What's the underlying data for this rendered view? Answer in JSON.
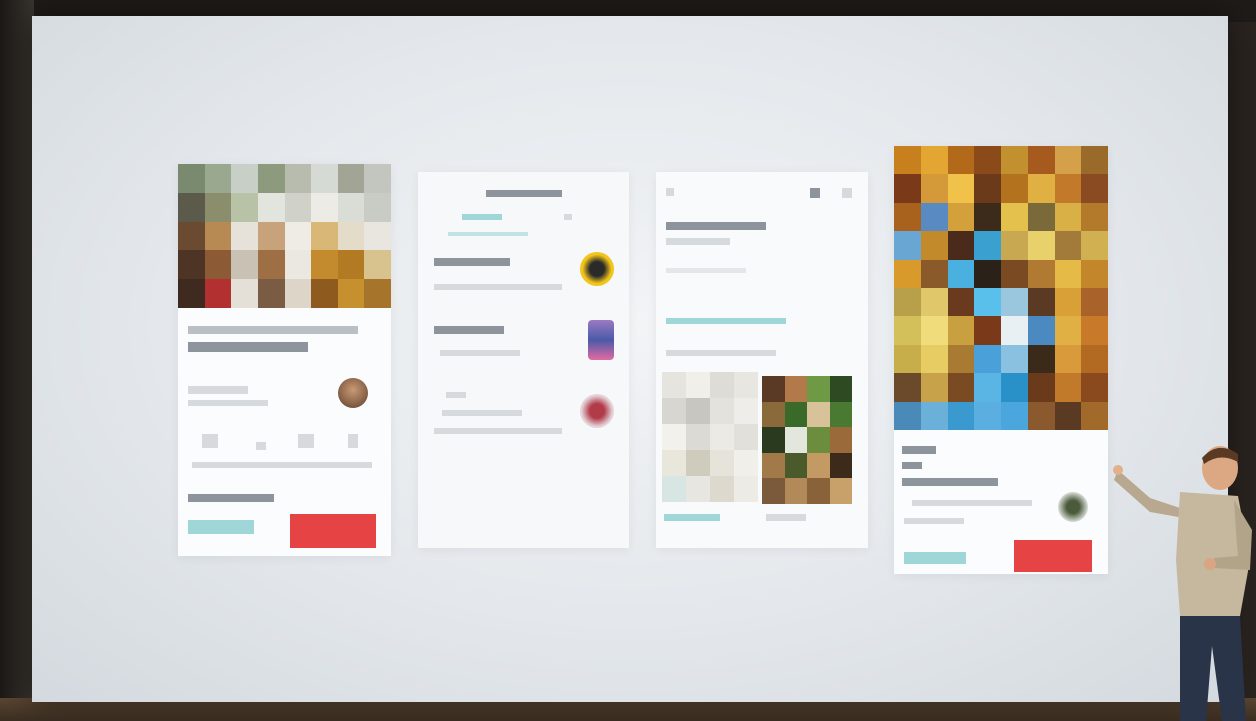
{
  "scene": {
    "description": "",
    "cards": [
      {
        "id": "restaurant-detail",
        "button_label": ""
      },
      {
        "id": "reviews-list",
        "button_label": ""
      },
      {
        "id": "article-detail",
        "button_label": ""
      },
      {
        "id": "dish-detail",
        "button_label": ""
      }
    ]
  },
  "colors": {
    "accent_red": "#e64444",
    "accent_teal": "#6fc9cc",
    "screen_bg": "#eceff2"
  }
}
